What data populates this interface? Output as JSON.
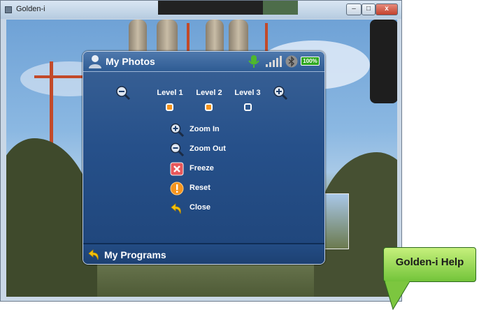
{
  "window": {
    "title": "Golden-i",
    "minimize": "–",
    "maximize": "□",
    "close": "x"
  },
  "panel": {
    "title": "My Photos",
    "battery": "100%",
    "levels": [
      "Level 1",
      "Level 2",
      "Level 3"
    ],
    "level_states": [
      true,
      true,
      false
    ],
    "menu": [
      {
        "label": "Zoom In",
        "icon": "zoom-in-icon"
      },
      {
        "label": "Zoom Out",
        "icon": "zoom-out-icon"
      },
      {
        "label": "Freeze",
        "icon": "freeze-icon"
      },
      {
        "label": "Reset",
        "icon": "warning-icon"
      },
      {
        "label": "Close",
        "icon": "back-arrow-icon"
      }
    ],
    "footer": "My Programs"
  },
  "help": {
    "label": "Golden-i Help"
  },
  "colors": {
    "panel": "#26508a",
    "accent": "#f7941d",
    "battery": "#2fa81f",
    "help_bubble": "#8fd24a"
  }
}
